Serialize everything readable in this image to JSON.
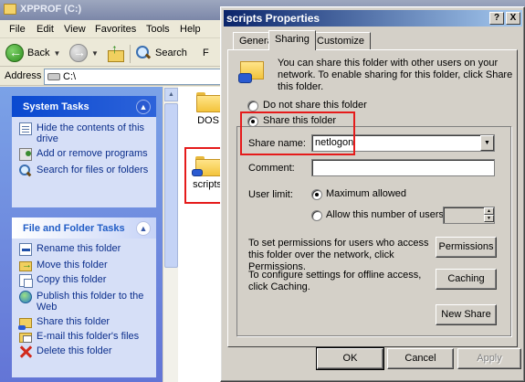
{
  "explorer": {
    "title": "XPPROF (C:)",
    "menu": [
      "File",
      "Edit",
      "View",
      "Favorites",
      "Tools",
      "Help"
    ],
    "toolbar": {
      "back_label": "Back",
      "search_label": "Search",
      "folders_label": "F"
    },
    "address": {
      "label": "Address",
      "value": "C:\\"
    },
    "system_tasks": {
      "title": "System Tasks",
      "items": [
        "Hide the contents of this drive",
        "Add or remove programs",
        "Search for files or folders"
      ]
    },
    "file_folder_tasks": {
      "title": "File and Folder Tasks",
      "items": [
        "Rename this folder",
        "Move this folder",
        "Copy this folder",
        "Publish this folder to the Web",
        "Share this folder",
        "E-mail this folder's files",
        "Delete this folder"
      ]
    },
    "folders": [
      "DOS",
      "scripts"
    ]
  },
  "dialog": {
    "title": "scripts Properties",
    "help_glyph": "?",
    "close_glyph": "X",
    "tabs": [
      "General",
      "Sharing",
      "Customize"
    ],
    "intro": "You can share this folder with other users on your network. To enable sharing for this folder, click Share this folder.",
    "radio_not_share": "Do not share this folder",
    "radio_share": "Share this folder",
    "share_name_label": "Share name:",
    "share_name_value": "netlogon",
    "comment_label": "Comment:",
    "comment_value": "",
    "user_limit_label": "User limit:",
    "max_allowed_label": "Maximum allowed",
    "allow_users_label": "Allow this number of users:",
    "user_count_value": "",
    "permissions_text": "To set permissions for users who access this folder over the network, click Permissions.",
    "permissions_button": "Permissions",
    "caching_text": "To configure settings for offline access, click Caching.",
    "caching_button": "Caching",
    "new_share_button": "New Share",
    "ok_button": "OK",
    "cancel_button": "Cancel",
    "apply_button": "Apply"
  }
}
